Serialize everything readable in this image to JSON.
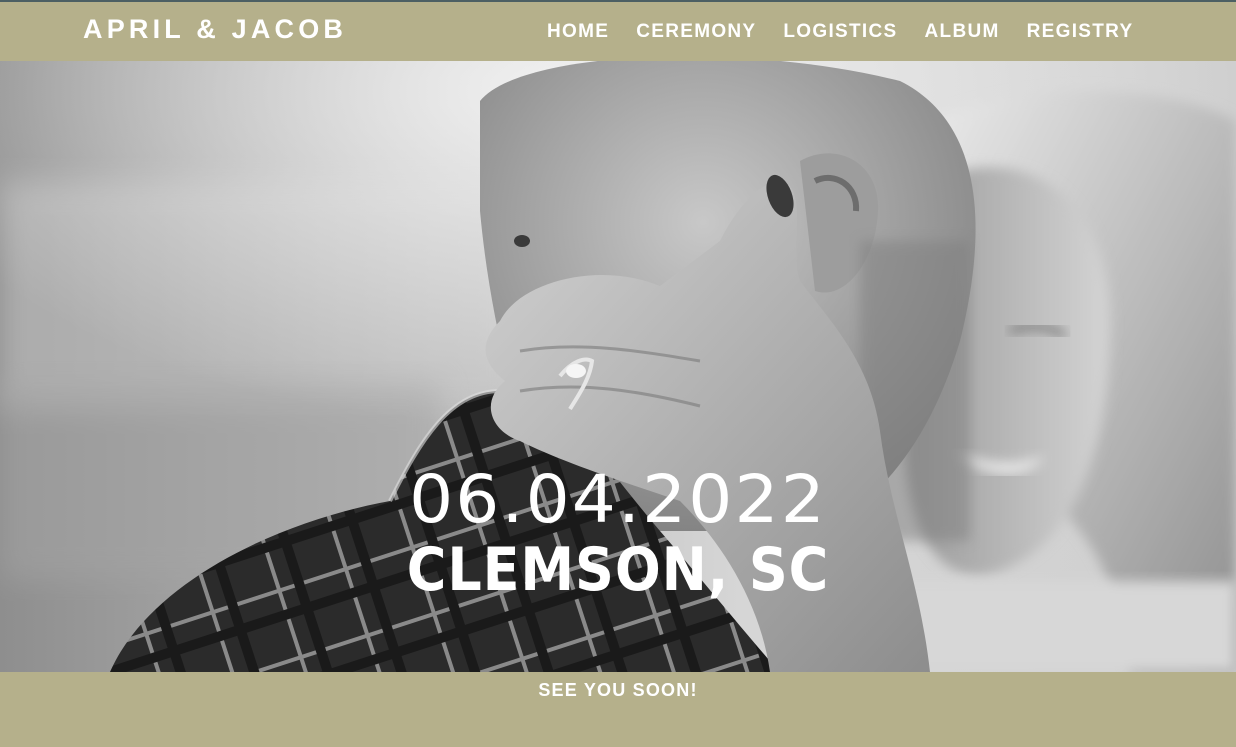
{
  "header": {
    "brand": "APRIL & JACOB",
    "nav": [
      {
        "label": "HOME"
      },
      {
        "label": "CEREMONY"
      },
      {
        "label": "LOGISTICS"
      },
      {
        "label": "ALBUM"
      },
      {
        "label": "REGISTRY"
      }
    ]
  },
  "hero": {
    "date": "06.04.2022",
    "place": "CLEMSON, SC",
    "photo_icon": "couple-photo"
  },
  "footer": {
    "tagline": "SEE YOU SOON!"
  },
  "colors": {
    "band": "#b5b08b",
    "text": "#ffffff",
    "accent_line": "#4c5f63"
  }
}
